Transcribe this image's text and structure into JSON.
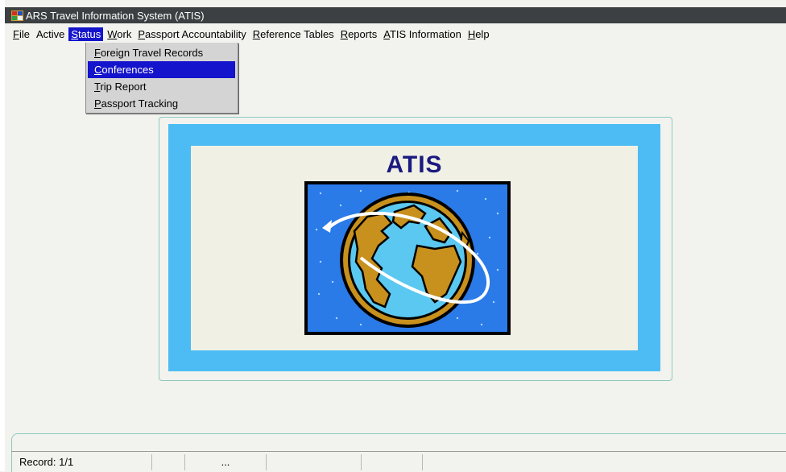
{
  "window": {
    "title": "ARS Travel Information System (ATIS)",
    "icon": "app-window-icon"
  },
  "menubar": {
    "items": [
      {
        "label": "File",
        "mnemonic": "F"
      },
      {
        "label": "Active",
        "mnemonic": ""
      },
      {
        "label": "Status",
        "mnemonic": "S"
      },
      {
        "label": "Work",
        "mnemonic": "W"
      },
      {
        "label": "Passport Accountability",
        "mnemonic": "P"
      },
      {
        "label": "Reference Tables",
        "mnemonic": "R"
      },
      {
        "label": "Reports",
        "mnemonic": "R"
      },
      {
        "label": "ATIS Information",
        "mnemonic": "A"
      },
      {
        "label": "Help",
        "mnemonic": "H"
      }
    ],
    "open_menu": "Status"
  },
  "status_menu": {
    "items": [
      {
        "label": "Foreign Travel Records",
        "mnemonic": "F",
        "selected": false
      },
      {
        "label": "Conferences",
        "mnemonic": "C",
        "selected": true
      },
      {
        "label": "Trip Report",
        "mnemonic": "T",
        "selected": false
      },
      {
        "label": "Passport Tracking",
        "mnemonic": "P",
        "selected": false
      }
    ]
  },
  "splash": {
    "title": "ATIS",
    "image": "globe-icon"
  },
  "statusbar": {
    "record": "Record: 1/1",
    "indicator": "..."
  },
  "colors": {
    "titlebar": "#3c4042",
    "menu_highlight": "#1414cc",
    "frame_blue": "#4dbcf5",
    "splash_title": "#1a1a80"
  }
}
